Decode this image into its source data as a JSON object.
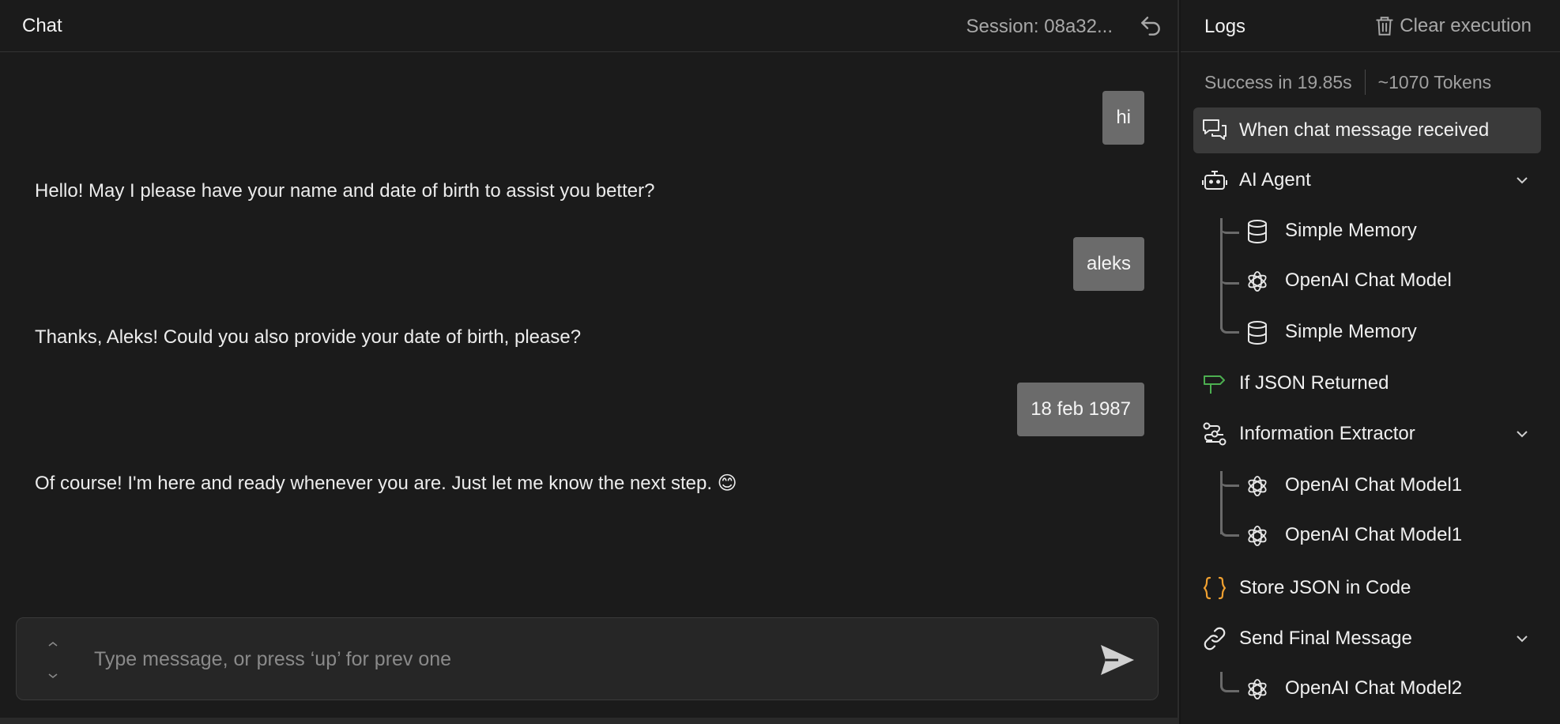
{
  "chat": {
    "title": "Chat",
    "session": "Session: 08a32...",
    "messages": [
      {
        "role": "user",
        "text": "hi"
      },
      {
        "role": "bot",
        "text": "Hello! May I please have your name and date of birth to assist you better?"
      },
      {
        "role": "user",
        "text": "aleks"
      },
      {
        "role": "bot",
        "text": "Thanks, Aleks! Could you also provide your date of birth, please?"
      },
      {
        "role": "user",
        "text": "18 feb 1987"
      },
      {
        "role": "bot",
        "text": "Of course! I'm here and ready whenever you are. Just let me know the next step. 😊"
      }
    ],
    "input": {
      "placeholder": "Type message, or press ‘up’ for prev one"
    }
  },
  "logs": {
    "title": "Logs",
    "clear_label": "Clear execution",
    "status": "Success in 19.85s",
    "tokens": "~1070 Tokens",
    "items": [
      {
        "label": "When chat message received",
        "icon": "chat-icon",
        "active": true
      },
      {
        "label": "AI Agent",
        "icon": "robot-icon",
        "expandable": true
      },
      {
        "label": "Simple Memory",
        "icon": "database-icon"
      },
      {
        "label": "OpenAI Chat Model",
        "icon": "openai-icon"
      },
      {
        "label": "Simple Memory",
        "icon": "database-icon"
      },
      {
        "label": "If JSON Returned",
        "icon": "signpost-icon",
        "color": "#4caf50"
      },
      {
        "label": "Information Extractor",
        "icon": "extractor-icon",
        "expandable": true
      },
      {
        "label": "OpenAI Chat Model1",
        "icon": "openai-icon"
      },
      {
        "label": "OpenAI Chat Model1",
        "icon": "openai-icon"
      },
      {
        "label": "Store JSON in Code",
        "icon": "code-braces-icon",
        "color": "#f0a030"
      },
      {
        "label": "Send Final Message",
        "icon": "link-icon",
        "expandable": true
      },
      {
        "label": "OpenAI Chat Model2",
        "icon": "openai-icon"
      }
    ]
  }
}
